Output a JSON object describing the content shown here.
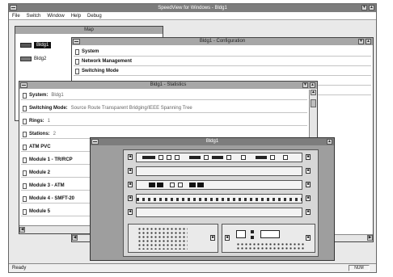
{
  "app": {
    "title": "SpeedView for Windows - Bldg1"
  },
  "menu": [
    "File",
    "Switch",
    "Window",
    "Help",
    "Debug"
  ],
  "map": {
    "title": "Map",
    "items": [
      {
        "label": "Bldg1",
        "selected": true
      },
      {
        "label": "Bldg2",
        "selected": false
      }
    ]
  },
  "config": {
    "title": "Bldg1 - Configuration",
    "rows": [
      {
        "label": "System"
      },
      {
        "label": "Network Management"
      },
      {
        "label": "Switching Mode"
      }
    ]
  },
  "stats": {
    "title": "Bldg1 - Statistics",
    "rows": [
      {
        "label": "System:",
        "value": "Bldg1"
      },
      {
        "label": "Switching Mode:",
        "value": "Source Route Transparent Bridging/IEEE Spanning Tree"
      },
      {
        "label": "Rings:",
        "value": "1"
      },
      {
        "label": "Stations:",
        "value": "2"
      },
      {
        "label": "ATM PVC",
        "value": ""
      },
      {
        "label": "Module 1 - TR/RCP",
        "value": ""
      },
      {
        "label": "Module 2",
        "value": ""
      },
      {
        "label": "Module 3 - ATM",
        "value": ""
      },
      {
        "label": "Module 4 - SMFT-20",
        "value": ""
      },
      {
        "label": "Module 5",
        "value": ""
      }
    ]
  },
  "device": {
    "title": "Bldg1"
  },
  "status": {
    "left": "Ready",
    "right": "NUM"
  },
  "icons": {
    "system_menu": "system-menu-icon",
    "minimize": "minimize-icon",
    "maximize": "maximize-icon",
    "scroll_up": "scroll-up-arrow-icon",
    "scroll_down": "scroll-down-arrow-icon",
    "scroll_left": "scroll-left-arrow-icon",
    "scroll_right": "scroll-right-arrow-icon",
    "switch": "switch-icon",
    "row": "document-icon",
    "port": "port-icon"
  },
  "colors": {
    "active_title": "#7d7d7d",
    "inactive_title": "#a7a7a7",
    "chassis": "#a9a9a9",
    "face": "#c0c0c0"
  }
}
